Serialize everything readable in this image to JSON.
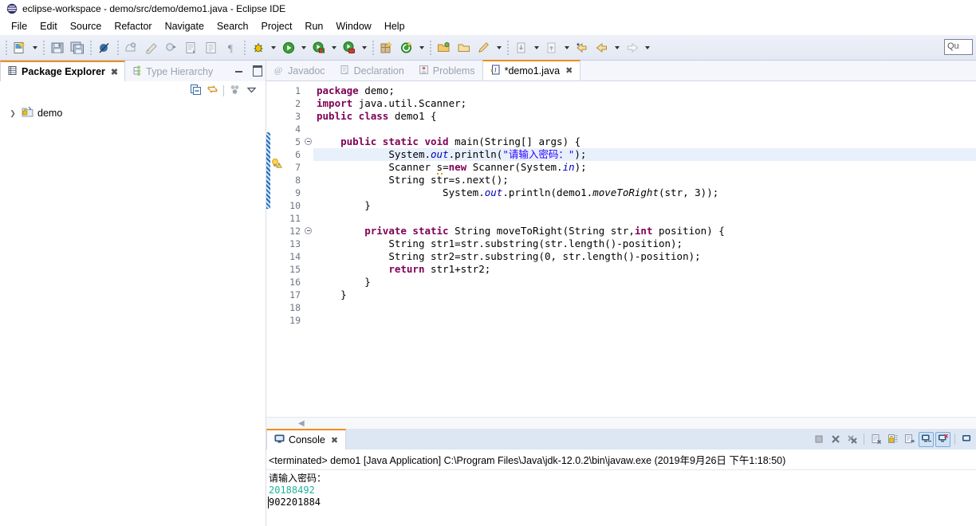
{
  "window": {
    "title": "eclipse-workspace - demo/src/demo/demo1.java - Eclipse IDE",
    "icon": "eclipse-icon"
  },
  "menubar": {
    "items": [
      {
        "label": "File",
        "name": "menu-file"
      },
      {
        "label": "Edit",
        "name": "menu-edit"
      },
      {
        "label": "Source",
        "name": "menu-source"
      },
      {
        "label": "Refactor",
        "name": "menu-refactor"
      },
      {
        "label": "Navigate",
        "name": "menu-navigate"
      },
      {
        "label": "Search",
        "name": "menu-search"
      },
      {
        "label": "Project",
        "name": "menu-project"
      },
      {
        "label": "Run",
        "name": "menu-run"
      },
      {
        "label": "Window",
        "name": "menu-window"
      },
      {
        "label": "Help",
        "name": "menu-help"
      }
    ]
  },
  "toolbar": {
    "quick_access_value": "Qu"
  },
  "package_explorer": {
    "tabs": [
      {
        "label": "Package Explorer",
        "active": true,
        "icon": "package-explorer-icon",
        "closable": true
      },
      {
        "label": "Type Hierarchy",
        "active": false,
        "icon": "type-hierarchy-icon",
        "closable": false
      }
    ],
    "tree": [
      {
        "label": "demo",
        "expanded": false,
        "icon": "java-project-icon"
      }
    ]
  },
  "editor": {
    "tabs": [
      {
        "label": "Javadoc",
        "active": false,
        "icon": "javadoc-icon"
      },
      {
        "label": "Declaration",
        "active": false,
        "icon": "declaration-icon"
      },
      {
        "label": "Problems",
        "active": false,
        "icon": "problems-icon"
      },
      {
        "label": "*demo1.java",
        "active": true,
        "icon": "java-file-icon"
      }
    ],
    "lines": [
      {
        "no": "1",
        "html": "<span class=\"kw\">package</span> <span class=\"plain\">demo;</span>"
      },
      {
        "no": "2",
        "html": "<span class=\"kw\">import</span> <span class=\"plain\">java.util.Scanner;</span>"
      },
      {
        "no": "3",
        "html": "<span class=\"kw\">public class</span> <span class=\"plain\">demo1 {</span>"
      },
      {
        "no": "4",
        "html": ""
      },
      {
        "no": "5",
        "html": "    <span class=\"kw\">public static void</span> <span class=\"plain\">main(String[] args) {</span>",
        "fold": true
      },
      {
        "no": "6",
        "html": "            <span class=\"plain\">System.</span><span class=\"fld\">out</span><span class=\"plain\">.println(</span><span class=\"str\">\"请输入密码：\"</span><span class=\"plain\">);</span>",
        "highlight": true
      },
      {
        "no": "7",
        "html": "            <span class=\"plain\">Scanner </span><span class=\"warn-underline\">s</span><span class=\"plain\">=</span><span class=\"kw\">new</span><span class=\"plain\"> Scanner(System.</span><span class=\"fld\">in</span><span class=\"plain\">);</span>",
        "marker": "warning"
      },
      {
        "no": "8",
        "html": "            <span class=\"plain\">String str=s.next();</span>"
      },
      {
        "no": "9",
        "html": "                     <span class=\"plain\">System.</span><span class=\"fld\">out</span><span class=\"plain\">.println(demo1.</span><span class=\"mth\">moveToRight</span><span class=\"plain\">(str, 3));</span>"
      },
      {
        "no": "10",
        "html": "        <span class=\"plain\">}</span>"
      },
      {
        "no": "11",
        "html": ""
      },
      {
        "no": "12",
        "html": "        <span class=\"kw\">private static</span> <span class=\"plain\">String moveToRight(String str,</span><span class=\"kw\">int</span><span class=\"plain\"> position) {</span>",
        "fold": true
      },
      {
        "no": "13",
        "html": "            <span class=\"plain\">String str1=str.substring(str.length()-position);</span>"
      },
      {
        "no": "14",
        "html": "            <span class=\"plain\">String str2=str.substring(0, str.length()-position);</span>"
      },
      {
        "no": "15",
        "html": "            <span class=\"kw\">return</span> <span class=\"plain\">str1+str2;</span>"
      },
      {
        "no": "16",
        "html": "        <span class=\"plain\">}</span>"
      },
      {
        "no": "17",
        "html": "    <span class=\"plain\">}</span>"
      },
      {
        "no": "18",
        "html": ""
      },
      {
        "no": "19",
        "html": ""
      }
    ]
  },
  "console": {
    "tab_label": "Console",
    "tab_icon": "console-icon",
    "header": "<terminated> demo1 [Java Application] C:\\Program Files\\Java\\jdk-12.0.2\\bin\\javaw.exe (2019年9月26日 下午1:18:50)",
    "output": [
      {
        "text": "请输入密码：",
        "kind": "out"
      },
      {
        "text": "20188492",
        "kind": "in"
      },
      {
        "text": "902201884",
        "kind": "out"
      }
    ],
    "buttons": [
      {
        "name": "terminate-button",
        "icon": "stop-icon"
      },
      {
        "name": "remove-launch-button",
        "icon": "remove-icon"
      },
      {
        "name": "remove-all-launches-button",
        "icon": "remove-all-icon"
      },
      {
        "name": "clear-console-button",
        "icon": "clear-icon"
      },
      {
        "name": "scroll-lock-button",
        "icon": "lock-icon"
      },
      {
        "name": "word-wrap-button",
        "icon": "wrap-icon"
      },
      {
        "name": "pin-console-button",
        "icon": "pin-icon",
        "active": true
      },
      {
        "name": "display-selected-console-button",
        "icon": "display-console-icon",
        "active": true
      },
      {
        "name": "open-console-button",
        "icon": "open-console-icon"
      }
    ]
  },
  "colors": {
    "accent_orange": "#f08c1e",
    "keyword_purple": "#7f0055",
    "string_blue": "#2a00ff",
    "field_blue": "#0000c0",
    "console_input_green": "#1fb39b",
    "highlight_line": "#e8f0fb"
  }
}
